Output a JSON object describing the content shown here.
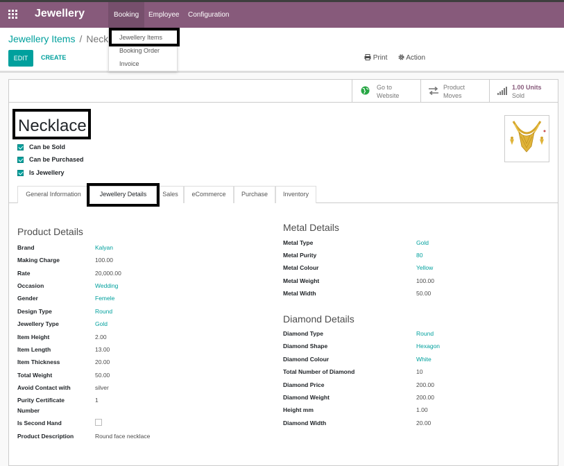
{
  "app": {
    "brand": "Jewellery"
  },
  "menu": {
    "booking": "Booking",
    "employee": "Employee",
    "configuration": "Configuration"
  },
  "dropdown": [
    "Jewellery Items",
    "Booking Order",
    "Invoice"
  ],
  "breadcrumb": {
    "parent": "Jewellery Items",
    "separator": "/",
    "current": "Neckl"
  },
  "toolbar": {
    "edit": "EDIT",
    "create": "CREATE",
    "print": "Print",
    "action": "Action"
  },
  "stats": {
    "website_line1": "Go to",
    "website_line2": "Website",
    "moves_line1": "Product",
    "moves_line2": "Moves",
    "sold_line1": "1.00 Units",
    "sold_line2": "Sold"
  },
  "product": {
    "name": "Necklace",
    "flags": [
      "Can be Sold",
      "Can be Purchased",
      "Is Jewellery"
    ]
  },
  "tabs": [
    "General Information",
    "Jewellery Details",
    "Sales",
    "eCommerce",
    "Purchase",
    "Inventory"
  ],
  "product_details": {
    "title": "Product Details",
    "rows": [
      {
        "label": "Brand",
        "value": "Kalyan"
      },
      {
        "label": "Making Charge",
        "value": "100.00"
      },
      {
        "label": "Rate",
        "value": "20,000.00"
      },
      {
        "label": "Occasion",
        "value": "Wedding"
      },
      {
        "label": "Gender",
        "value": "Femele"
      },
      {
        "label": "Design Type",
        "value": "Round"
      },
      {
        "label": "Jewellery Type",
        "value": "Gold"
      },
      {
        "label": "Item Height",
        "value": "2.00"
      },
      {
        "label": "Item Length",
        "value": "13.00"
      },
      {
        "label": "Item Thickness",
        "value": "20.00"
      },
      {
        "label": "Total Weight",
        "value": "50.00"
      },
      {
        "label": "Avoid Contact with",
        "value": "silver"
      },
      {
        "label": "Purity Certificate",
        "label2": "Number",
        "value": "1"
      },
      {
        "label": "Is Second Hand",
        "value": ""
      },
      {
        "label": "Product Description",
        "value": "Round face necklace"
      }
    ]
  },
  "metal_details": {
    "title": "Metal Details",
    "rows": [
      {
        "label": "Metal Type",
        "value": "Gold"
      },
      {
        "label": "Metal Purity",
        "value": "80"
      },
      {
        "label": "Metal Colour",
        "value": "Yellow"
      },
      {
        "label": "Metal Weight",
        "value": "100.00"
      },
      {
        "label": "Metal Width",
        "value": "50.00"
      }
    ]
  },
  "diamond_details": {
    "title": "Diamond Details",
    "rows": [
      {
        "label": "Diamond Type",
        "value": "Round"
      },
      {
        "label": "Diamond Shape",
        "value": "Hexagon"
      },
      {
        "label": "Diamond Colour",
        "value": "White"
      },
      {
        "label": "Total Number of Diamond",
        "value": "10"
      },
      {
        "label": "Diamond Price",
        "value": "200.00"
      },
      {
        "label": "Diamond Weight",
        "value": "200.00"
      },
      {
        "label": "Height mm",
        "value": "1.00"
      },
      {
        "label": "Diamond Width",
        "value": "20.00"
      }
    ]
  },
  "colors": {
    "topbar": "#875a7b",
    "accent": "#00a09d"
  }
}
